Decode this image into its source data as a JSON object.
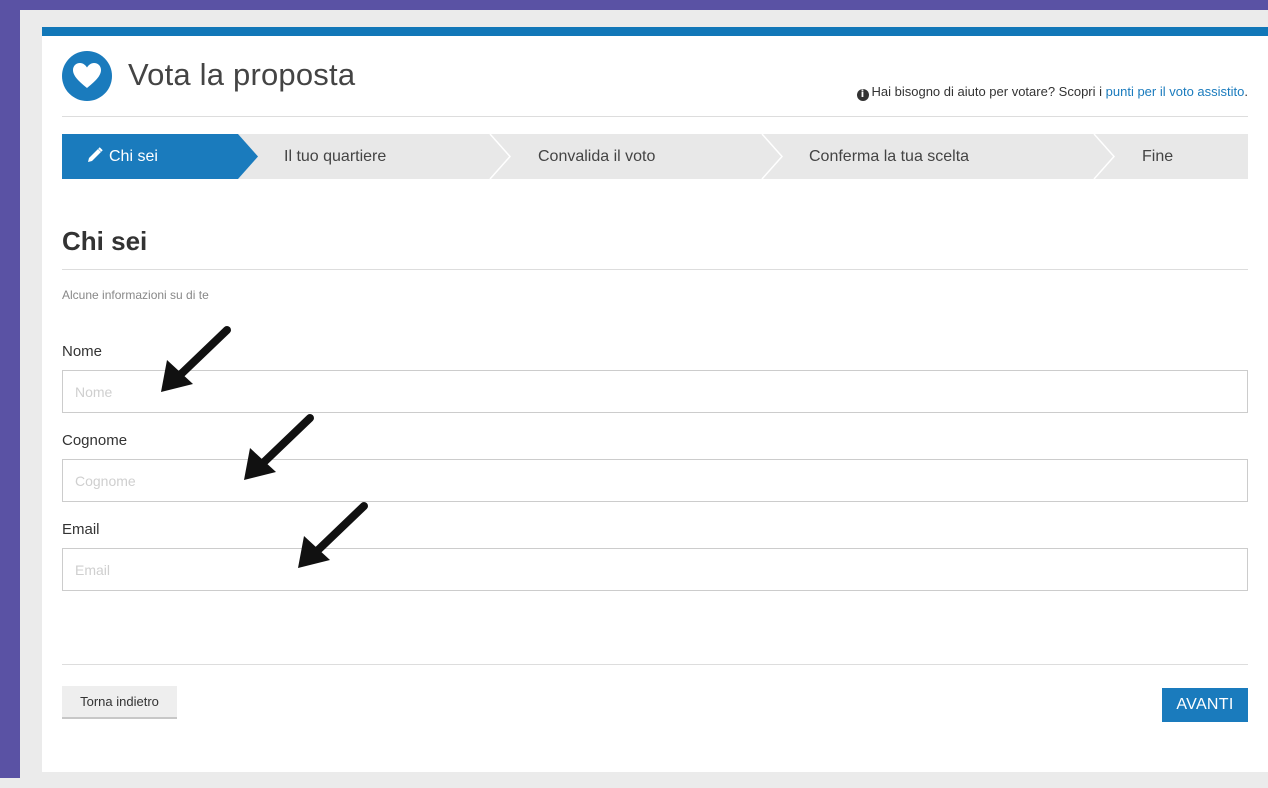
{
  "header": {
    "title": "Vota la proposta",
    "logo_icon": "heart-icon",
    "help_text": "Hai bisogno di aiuto per votare? Scopri i ",
    "help_link": "punti per il voto assistito",
    "help_suffix": "."
  },
  "steps": [
    {
      "label": "Chi sei",
      "active": true,
      "icon": "pencil-icon"
    },
    {
      "label": "Il tuo quartiere",
      "active": false
    },
    {
      "label": "Convalida il voto",
      "active": false
    },
    {
      "label": "Conferma la tua scelta",
      "active": false
    },
    {
      "label": "Fine",
      "active": false
    }
  ],
  "section": {
    "title": "Chi sei",
    "subtitle": "Alcune informazioni su di te"
  },
  "form": {
    "fields": [
      {
        "label": "Nome",
        "placeholder": "Nome",
        "value": ""
      },
      {
        "label": "Cognome",
        "placeholder": "Cognome",
        "value": ""
      },
      {
        "label": "Email",
        "placeholder": "Email",
        "value": ""
      }
    ]
  },
  "actions": {
    "back_label": "Torna indietro",
    "next_label": "AVANTI"
  },
  "colors": {
    "accent": "#1a7bbd",
    "frame": "#5a52a4",
    "step_inactive": "#e8e8e8"
  }
}
